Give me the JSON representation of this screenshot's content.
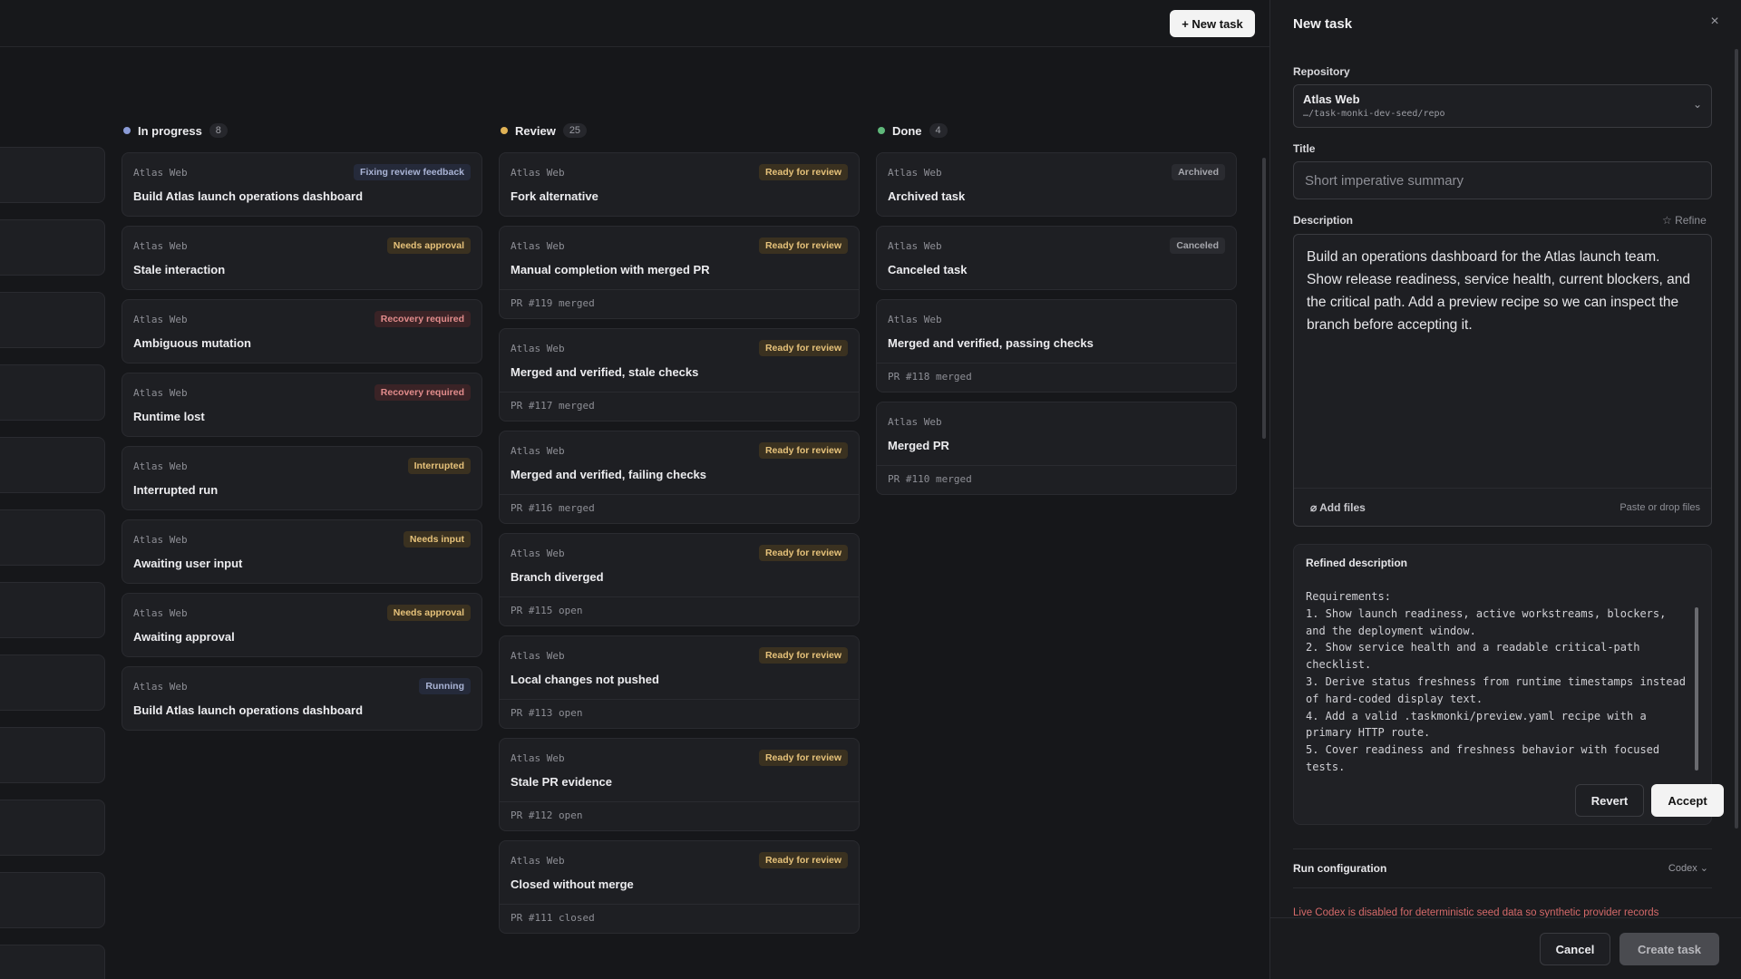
{
  "topbar": {
    "new_task_label": "+ New task"
  },
  "columns": [
    {
      "title": "In progress",
      "count": "8",
      "dot_color": "#8a9bd6",
      "cards": [
        {
          "repo": "Atlas Web",
          "badge": "Fixing review feedback",
          "badge_style": "b-blue",
          "title": "Build Atlas launch operations dashboard",
          "pr": ""
        },
        {
          "repo": "Atlas Web",
          "badge": "Needs approval",
          "badge_style": "b-amber",
          "title": "Stale interaction",
          "pr": ""
        },
        {
          "repo": "Atlas Web",
          "badge": "Recovery required",
          "badge_style": "b-red",
          "title": "Ambiguous mutation",
          "pr": ""
        },
        {
          "repo": "Atlas Web",
          "badge": "Recovery required",
          "badge_style": "b-red",
          "title": "Runtime lost",
          "pr": ""
        },
        {
          "repo": "Atlas Web",
          "badge": "Interrupted",
          "badge_style": "b-amber",
          "title": "Interrupted run",
          "pr": ""
        },
        {
          "repo": "Atlas Web",
          "badge": "Needs input",
          "badge_style": "b-amber",
          "title": "Awaiting user input",
          "pr": ""
        },
        {
          "repo": "Atlas Web",
          "badge": "Needs approval",
          "badge_style": "b-amber",
          "title": "Awaiting approval",
          "pr": ""
        },
        {
          "repo": "Atlas Web",
          "badge": "Running",
          "badge_style": "b-blue",
          "title": "Build Atlas launch operations dashboard",
          "pr": ""
        }
      ]
    },
    {
      "title": "Review",
      "count": "25",
      "dot_color": "#e0b255",
      "cards": [
        {
          "repo": "Atlas Web",
          "badge": "Ready for review",
          "badge_style": "b-amber",
          "title": "Fork alternative",
          "pr": ""
        },
        {
          "repo": "Atlas Web",
          "badge": "Ready for review",
          "badge_style": "b-amber",
          "title": "Manual completion with merged PR",
          "pr": "PR #119 merged"
        },
        {
          "repo": "Atlas Web",
          "badge": "Ready for review",
          "badge_style": "b-amber",
          "title": "Merged and verified, stale checks",
          "pr": "PR #117 merged"
        },
        {
          "repo": "Atlas Web",
          "badge": "Ready for review",
          "badge_style": "b-amber",
          "title": "Merged and verified, failing checks",
          "pr": "PR #116 merged"
        },
        {
          "repo": "Atlas Web",
          "badge": "Ready for review",
          "badge_style": "b-amber",
          "title": "Branch diverged",
          "pr": "PR #115 open"
        },
        {
          "repo": "Atlas Web",
          "badge": "Ready for review",
          "badge_style": "b-amber",
          "title": "Local changes not pushed",
          "pr": "PR #113 open"
        },
        {
          "repo": "Atlas Web",
          "badge": "Ready for review",
          "badge_style": "b-amber",
          "title": "Stale PR evidence",
          "pr": "PR #112 open"
        },
        {
          "repo": "Atlas Web",
          "badge": "Ready for review",
          "badge_style": "b-amber",
          "title": "Closed without merge",
          "pr": "PR #111 closed"
        }
      ]
    },
    {
      "title": "Done",
      "count": "4",
      "dot_color": "#5fb87a",
      "cards": [
        {
          "repo": "Atlas Web",
          "badge": "Archived",
          "badge_style": "b-gray",
          "title": "Archived task",
          "pr": ""
        },
        {
          "repo": "Atlas Web",
          "badge": "Canceled",
          "badge_style": "b-gray",
          "title": "Canceled task",
          "pr": ""
        },
        {
          "repo": "Atlas Web",
          "badge": "",
          "badge_style": "b-gray",
          "title": "Merged and verified, passing checks",
          "pr": "PR #118 merged"
        },
        {
          "repo": "Atlas Web",
          "badge": "",
          "badge_style": "b-gray",
          "title": "Merged PR",
          "pr": "PR #110 merged"
        }
      ]
    }
  ],
  "panel": {
    "title": "New task",
    "close_icon": "×",
    "repository_label": "Repository",
    "repository_name": "Atlas Web",
    "repository_path": "…/task-monki-dev-seed/repo",
    "title_label": "Title",
    "title_placeholder": "Short imperative summary",
    "description_label": "Description",
    "refine_label": "☆ Refine",
    "description_text": "Build an operations dashboard for the Atlas launch team. Show release readiness, service health, current blockers, and the critical path. Add a preview recipe so we can inspect the branch before accepting it.",
    "add_files_label": "⌀ Add files",
    "paste_hint": "Paste or drop files",
    "refined_title": "Refined description",
    "refined_text": "Requirements:\n1. Show launch readiness, active workstreams, blockers, and the deployment window.\n2. Show service health and a readable critical-path checklist.\n3. Derive status freshness from runtime timestamps instead of hard-coded display text.\n4. Add a valid .taskmonki/preview.yaml recipe with a primary HTTP route.\n5. Cover readiness and freshness behavior with focused tests.",
    "revert_label": "Revert",
    "accept_label": "Accept",
    "run_config_label": "Run configuration",
    "run_config_value": "Codex ⌄",
    "warning": "Live Codex is disabled for deterministic seed data so synthetic provider records",
    "cancel_label": "Cancel",
    "create_label": "Create task"
  }
}
